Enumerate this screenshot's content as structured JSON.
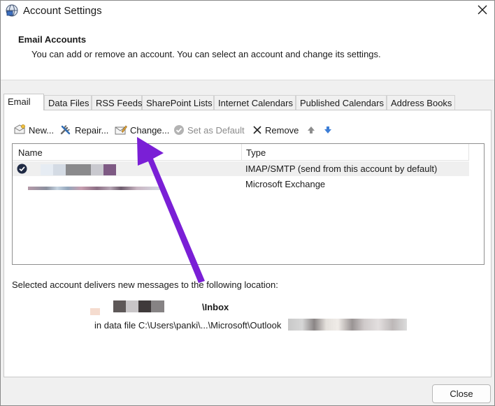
{
  "window": {
    "title": "Account Settings",
    "close_glyph": "✕"
  },
  "header": {
    "title": "Email Accounts",
    "description": "You can add or remove an account. You can select an account and change its settings."
  },
  "tabs": [
    {
      "label": "Email",
      "active": true
    },
    {
      "label": "Data Files"
    },
    {
      "label": "RSS Feeds"
    },
    {
      "label": "SharePoint Lists"
    },
    {
      "label": "Internet Calendars"
    },
    {
      "label": "Published Calendars"
    },
    {
      "label": "Address Books"
    }
  ],
  "toolbar": {
    "new_label": "New...",
    "repair_label": "Repair...",
    "change_label": "Change...",
    "default_label": "Set as Default",
    "remove_label": "Remove"
  },
  "list": {
    "columns": {
      "name": "Name",
      "type": "Type"
    },
    "rows": [
      {
        "type": "IMAP/SMTP (send from this account by default)",
        "selected": true
      },
      {
        "type": "Microsoft Exchange",
        "selected": false
      }
    ]
  },
  "delivery": {
    "label": "Selected account delivers new messages to the following location:",
    "folder": "\\Inbox",
    "data_file": "in data file C:\\Users\\panki\\...\\Microsoft\\Outlook"
  },
  "footer": {
    "close_label": "Close"
  },
  "colors": {
    "accent": "#7a1fd6",
    "check": "#1f2a44",
    "arrow_up": "#8e8e8e",
    "arrow_down": "#3d7ed6"
  }
}
